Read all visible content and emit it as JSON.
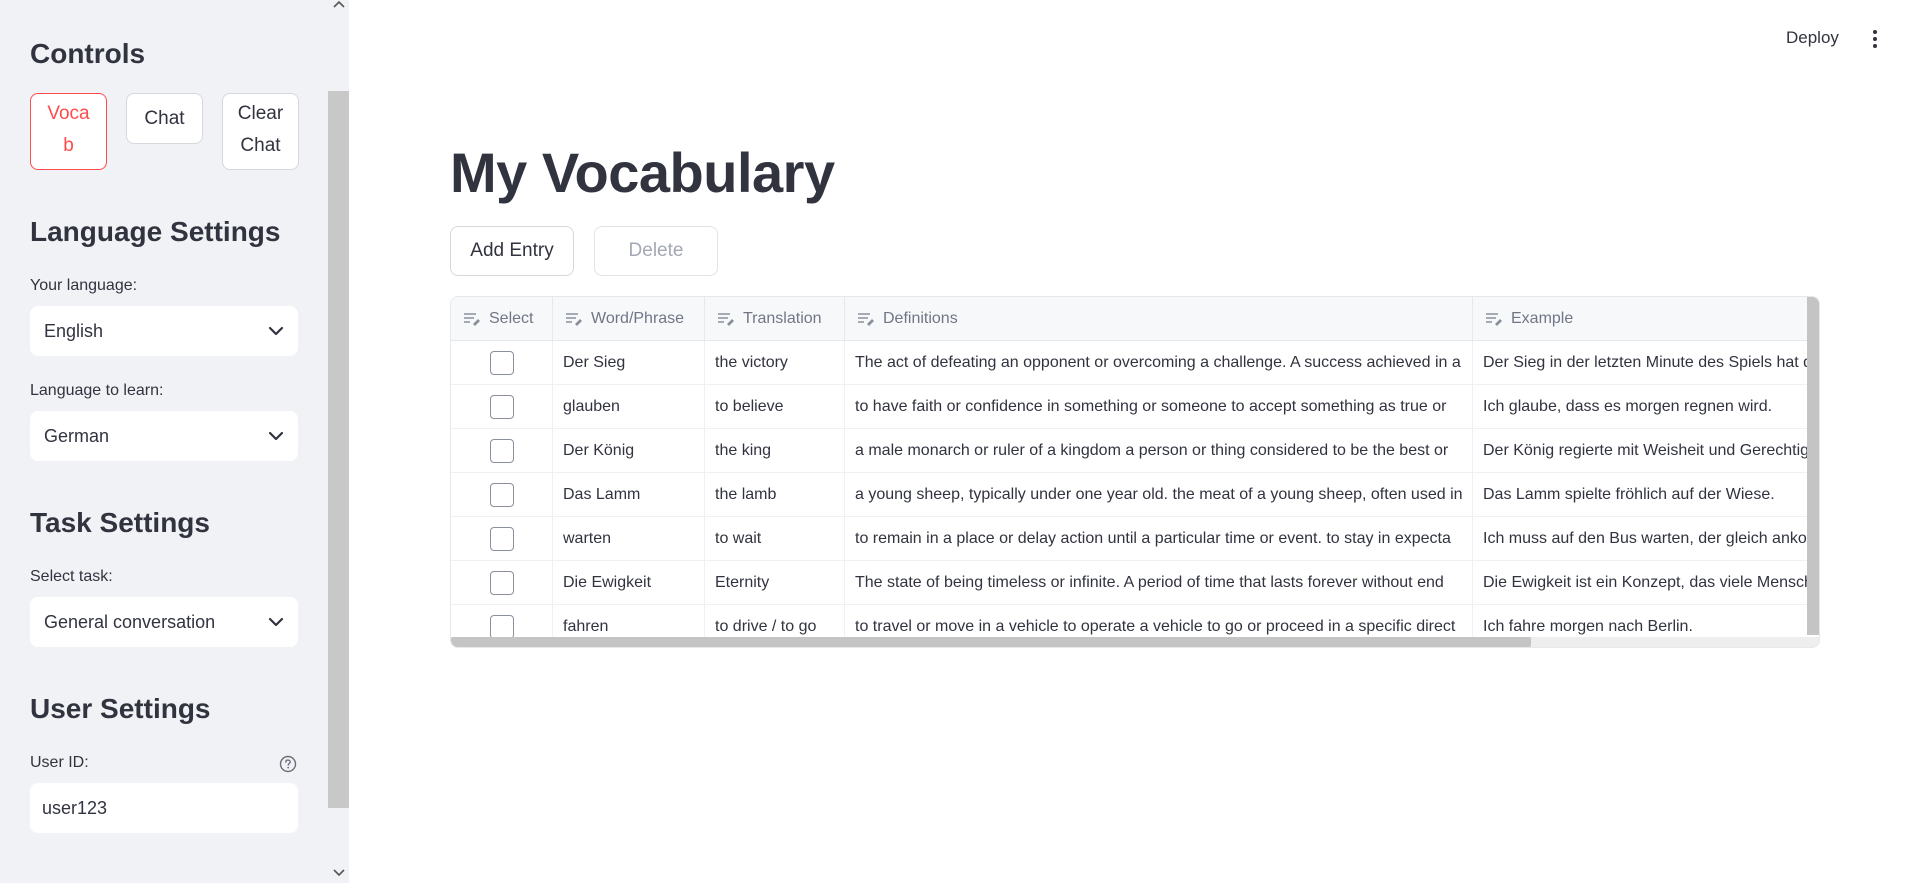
{
  "sidebar": {
    "controls_heading": "Controls",
    "buttons": {
      "vocab": "Vocab",
      "chat": "Chat",
      "clear_chat": "Clear Chat"
    },
    "language_heading": "Language Settings",
    "your_language_label": "Your language:",
    "your_language_value": "English",
    "learn_language_label": "Language to learn:",
    "learn_language_value": "German",
    "task_heading": "Task Settings",
    "task_label": "Select task:",
    "task_value": "General conversation",
    "user_heading": "User Settings",
    "user_id_label": "User ID:",
    "user_id_value": "user123"
  },
  "topbar": {
    "deploy_label": "Deploy"
  },
  "main": {
    "title": "My Vocabulary",
    "add_entry_label": "Add Entry",
    "delete_label": "Delete"
  },
  "table": {
    "headers": [
      "Select",
      "Word/Phrase",
      "Translation",
      "Definitions",
      "Example"
    ],
    "rows": [
      {
        "word": "Der Sieg",
        "translation": "the victory",
        "definition": "The act of defeating an opponent or overcoming a challenge. A success achieved in a",
        "example": "Der Sieg in der letzten Minute des Spiels hat d"
      },
      {
        "word": "glauben",
        "translation": "to believe",
        "definition": "to have faith or confidence in something or someone to accept something as true or",
        "example": "Ich glaube, dass es morgen regnen wird."
      },
      {
        "word": "Der König",
        "translation": "the king",
        "definition": "a male monarch or ruler of a kingdom a person or thing considered to be the best or",
        "example": "Der König regierte mit Weisheit und Gerechtig"
      },
      {
        "word": "Das Lamm",
        "translation": "the lamb",
        "definition": "a young sheep, typically under one year old. the meat of a young sheep, often used in",
        "example": "Das Lamm spielte fröhlich auf der Wiese."
      },
      {
        "word": "warten",
        "translation": "to wait",
        "definition": "to remain in a place or delay action until a particular time or event. to stay in expecta",
        "example": "Ich muss auf den Bus warten, der gleich ankom"
      },
      {
        "word": "Die Ewigkeit",
        "translation": "Eternity",
        "definition": "The state of being timeless or infinite. A period of time that lasts forever without end",
        "example": "Die Ewigkeit ist ein Konzept, das viele Mensch"
      },
      {
        "word": "fahren",
        "translation": "to drive / to go",
        "definition": "to travel or move in a vehicle to operate a vehicle to go or proceed in a specific direct",
        "example": "Ich fahre morgen nach Berlin."
      }
    ]
  }
}
